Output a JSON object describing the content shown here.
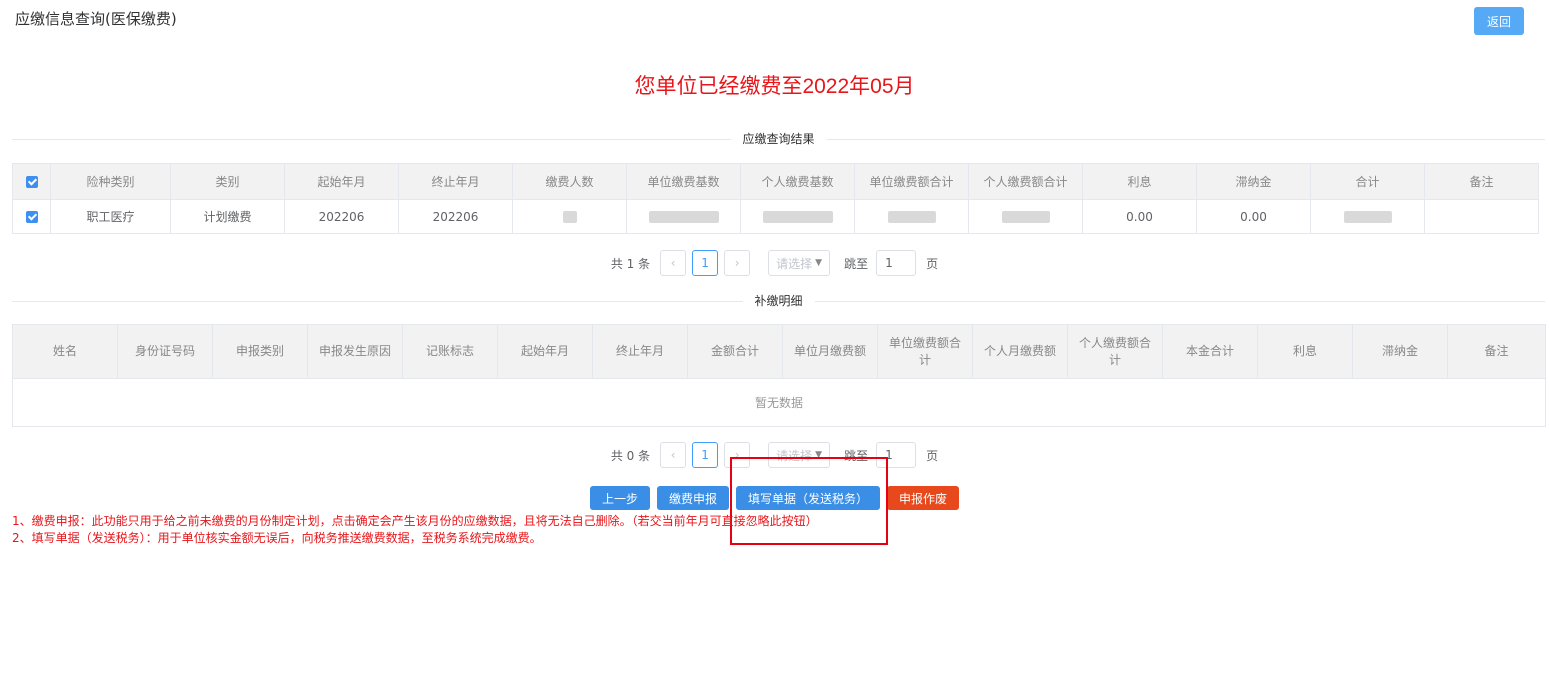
{
  "header": {
    "title": "应缴信息查询(医保缴费)",
    "back_label": "返回"
  },
  "banner": "您单位已经缴费至2022年05月",
  "section1": {
    "title": "应缴查询结果",
    "columns": [
      "险种类别",
      "类别",
      "起始年月",
      "终止年月",
      "缴费人数",
      "单位缴费基数",
      "个人缴费基数",
      "单位缴费额合计",
      "个人缴费额合计",
      "利息",
      "滞纳金",
      "合计",
      "备注"
    ],
    "rows": [
      {
        "insurance_type": "职工医疗",
        "category": "计划缴费",
        "start": "202206",
        "end": "202206",
        "interest": "0.00",
        "late_fee": "0.00"
      }
    ],
    "pager": {
      "total": "共 1 条",
      "page": "1",
      "select_placeholder": "请选择",
      "jump_label": "跳至",
      "jump_value": "1",
      "page_unit": "页",
      "prev": "‹",
      "next": "›"
    }
  },
  "section2": {
    "title": "补缴明细",
    "columns": [
      "姓名",
      "身份证号码",
      "申报类别",
      "申报发生原因",
      "记账标志",
      "起始年月",
      "终止年月",
      "金额合计",
      "单位月缴费额",
      "单位缴费额合计",
      "个人月缴费额",
      "个人缴费额合计",
      "本金合计",
      "利息",
      "滞纳金",
      "备注"
    ],
    "empty_text": "暂无数据",
    "pager": {
      "total": "共 0 条",
      "page": "1",
      "select_placeholder": "请选择",
      "jump_label": "跳至",
      "jump_value": "1",
      "page_unit": "页",
      "prev": "‹",
      "next": "›"
    }
  },
  "actions": {
    "prev_step": "上一步",
    "declare": "缴费申报",
    "fill_bill": "填写单据（发送税务）",
    "void": "申报作废"
  },
  "notes": [
    "1、缴费申报：此功能只用于给之前未缴费的月份制定计划，点击确定会产生该月份的应缴数据，且将无法自己删除。（若交当前年月可直接忽略此按钮）",
    "2、填写单据（发送税务）：用于单位核实金额无误后，向税务推送缴费数据，至税务系统完成缴费。"
  ],
  "colors": {
    "accent": "#3a8ee6",
    "danger": "#e8151a",
    "void_button": "#e8491c"
  }
}
